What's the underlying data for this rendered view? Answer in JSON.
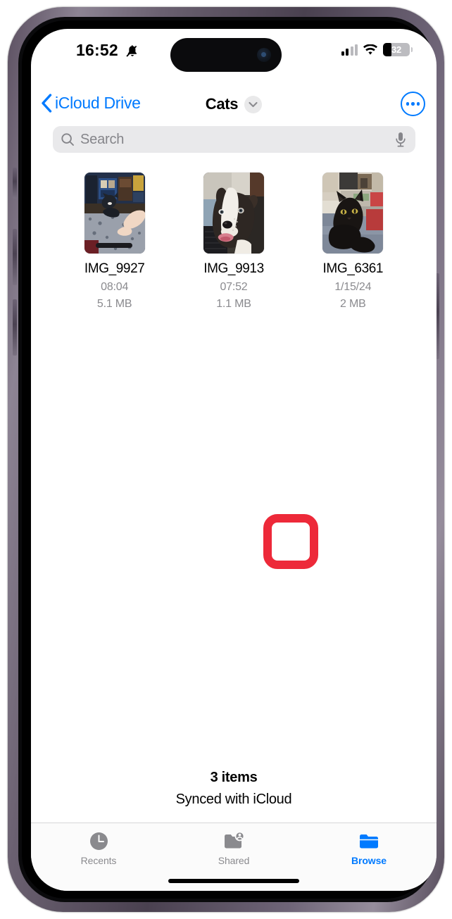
{
  "device": {
    "frame_color": "#5b4f60",
    "screen_bg": "#ffffff"
  },
  "status_bar": {
    "time": "16:52",
    "silent_icon": "bell-slash-icon",
    "cellular_icon": "signal-bars-icon",
    "wifi_icon": "wifi-icon",
    "battery_percent": "32",
    "battery_level": 32
  },
  "nav_bar": {
    "back_label": "iCloud Drive",
    "back_icon": "chevron-left-icon",
    "title": "Cats",
    "title_chevron_icon": "chevron-down-icon",
    "more_icon": "ellipsis-circle-icon",
    "accent_color": "#007aff"
  },
  "search": {
    "placeholder": "Search",
    "value": "",
    "search_icon": "magnifying-glass-icon",
    "mic_icon": "microphone-icon"
  },
  "files": [
    {
      "name": "IMG_9927",
      "meta": "08:04",
      "size": "5.1 MB",
      "thumbnail": "photo-cat-on-rug"
    },
    {
      "name": "IMG_9913",
      "meta": "07:52",
      "size": "1.1 MB",
      "thumbnail": "photo-pitbull-dog"
    },
    {
      "name": "IMG_6361",
      "meta": "1/15/24",
      "size": "2 MB",
      "thumbnail": "photo-black-cat"
    }
  ],
  "annotation": {
    "shape": "rounded-square-outline",
    "color": "#ed2939"
  },
  "footer": {
    "item_count": "3 items",
    "sync_status": "Synced with iCloud"
  },
  "tab_bar": {
    "items": [
      {
        "label": "Recents",
        "icon": "clock-icon",
        "selected": false
      },
      {
        "label": "Shared",
        "icon": "folder-person-icon",
        "selected": false
      },
      {
        "label": "Browse",
        "icon": "folder-icon",
        "selected": true
      }
    ]
  }
}
